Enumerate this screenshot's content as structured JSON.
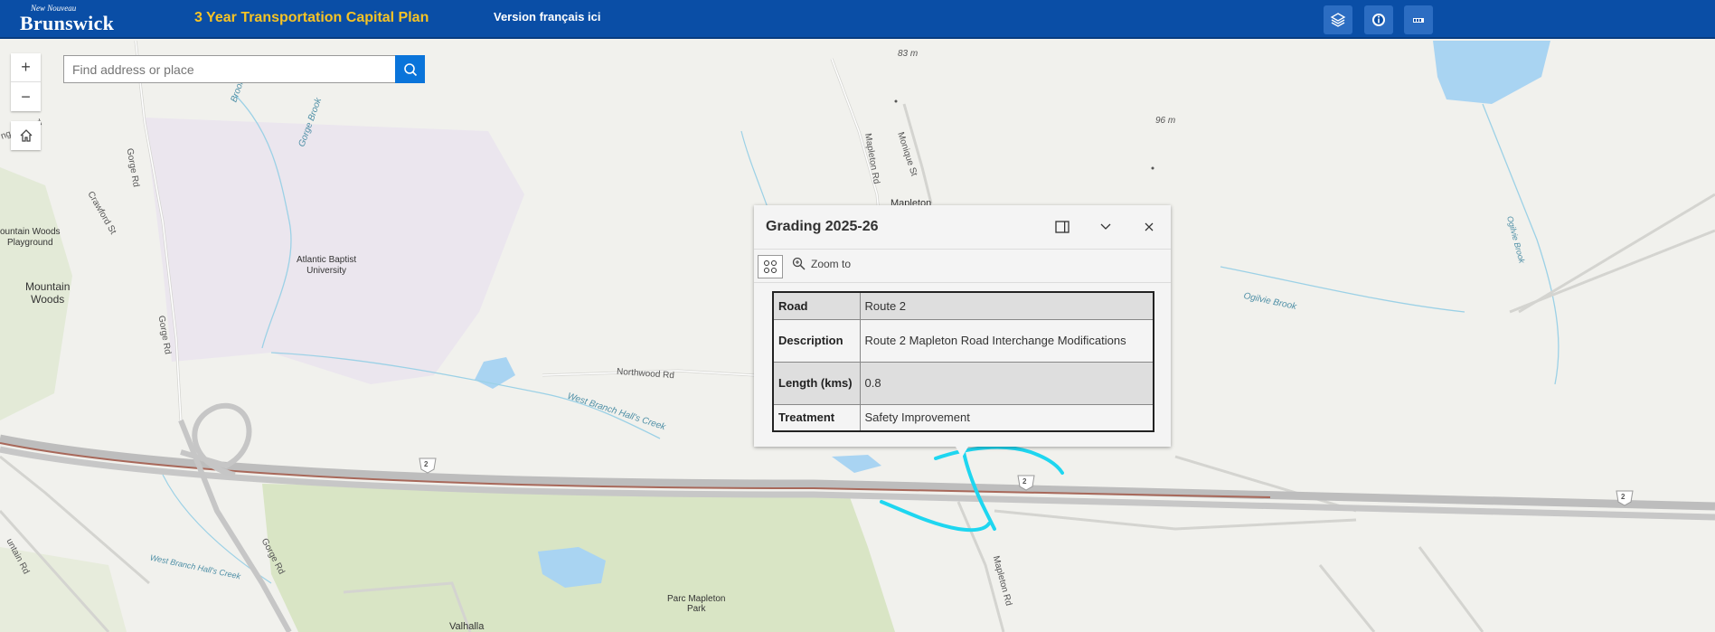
{
  "header": {
    "logo_small": "New Nouveau",
    "logo_big": "Brunswick",
    "title": "3 Year Transportation Capital Plan",
    "lang_link": "Version français ici",
    "buttons": [
      {
        "icon": "layers-icon"
      },
      {
        "icon": "info-icon"
      },
      {
        "icon": "legend-icon"
      }
    ]
  },
  "zoom": {
    "in": "+",
    "out": "−"
  },
  "search": {
    "placeholder": "Find address or place",
    "value": ""
  },
  "map_labels": {
    "elev1": "83 m",
    "elev2": "96 m",
    "gorge_rd": "Gorge Rd",
    "gorge_rd_2": "Gorge Rd",
    "gorge_rd_3": "Gorge Rd",
    "gorge_brook": "Gorge Brook",
    "brook": "Brook",
    "crawford": "Crawford St",
    "ridge_blvd": "ng   ge Blvd",
    "mountain_woods_playground": "ountain Woods\nPlayground",
    "mountain_woods": "Mountain\nWoods",
    "atlantic_baptist": "Atlantic Baptist\nUniversity",
    "mapleton_rd_n": "Mapleton Rd",
    "monique_st": "Monique St",
    "mapleton": "Mapleton",
    "northwood_rd": "Northwood Rd",
    "west_branch": "West Branch Hall's Creek",
    "west_branch_2": "West Branch Hall's Creek",
    "ogilvie_brook": "Ogilvie Brook",
    "ogilvie_brook_2": "Ogilvie Brook",
    "mountain_rd": "untain Rd",
    "parc_mapleton": "Parc Mapleton\nPark",
    "mapleton_rd_s": "Mapleton Rd",
    "valhalla": "Valhalla",
    "route_shield": "2"
  },
  "popup": {
    "title": "Grading 2025-26",
    "zoom_to": "Zoom to",
    "rows": [
      {
        "key": "Road",
        "value": "Route 2"
      },
      {
        "key": "Description",
        "value": "Route 2 Mapleton Road Interchange Modifications"
      },
      {
        "key": "Length (kms)",
        "value": "0.8"
      },
      {
        "key": "Treatment",
        "value": "Safety Improvement"
      }
    ]
  },
  "colors": {
    "header_bg": "#0a4ea6",
    "title_accent": "#f6c325",
    "highlight": "#1ed6f0",
    "search_btn": "#0a74da"
  }
}
